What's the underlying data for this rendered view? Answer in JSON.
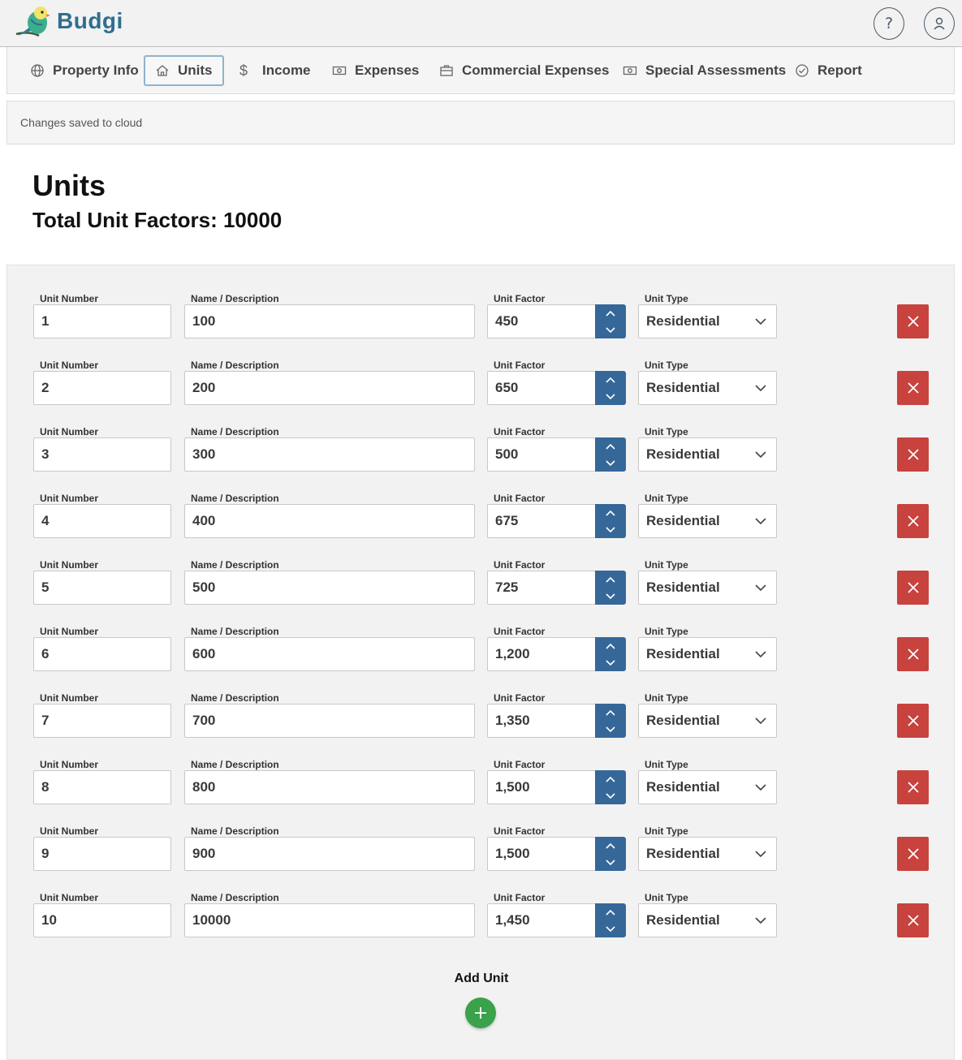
{
  "app": {
    "brand": "Budgi"
  },
  "header": {
    "help_icon": "question-icon",
    "user_icon": "user-icon"
  },
  "nav": {
    "tabs": [
      {
        "label": "Property Info",
        "icon": "globe-icon"
      },
      {
        "label": "Units",
        "icon": "home-icon",
        "active": true
      },
      {
        "label": "Income",
        "icon": "dollar-icon"
      },
      {
        "label": "Expenses",
        "icon": "cash-icon"
      },
      {
        "label": "Commercial Expenses",
        "icon": "briefcase-icon"
      },
      {
        "label": "Special Assessments",
        "icon": "cash-icon"
      },
      {
        "label": "Report",
        "icon": "check-circle-icon"
      }
    ]
  },
  "status": {
    "text": "Changes saved to cloud"
  },
  "page": {
    "title": "Units",
    "subtitle": "Total Unit Factors: 10000"
  },
  "labels": {
    "unit_number": "Unit Number",
    "name_description": "Name / Description",
    "unit_factor": "Unit Factor",
    "unit_type": "Unit Type"
  },
  "units": [
    {
      "number": "1",
      "name": "100",
      "factor": "450",
      "type": "Residential"
    },
    {
      "number": "2",
      "name": "200",
      "factor": "650",
      "type": "Residential"
    },
    {
      "number": "3",
      "name": "300",
      "factor": "500",
      "type": "Residential"
    },
    {
      "number": "4",
      "name": "400",
      "factor": "675",
      "type": "Residential"
    },
    {
      "number": "5",
      "name": "500",
      "factor": "725",
      "type": "Residential"
    },
    {
      "number": "6",
      "name": "600",
      "factor": "1,200",
      "type": "Residential"
    },
    {
      "number": "7",
      "name": "700",
      "factor": "1,350",
      "type": "Residential"
    },
    {
      "number": "8",
      "name": "800",
      "factor": "1,500",
      "type": "Residential"
    },
    {
      "number": "9",
      "name": "900",
      "factor": "1,500",
      "type": "Residential"
    },
    {
      "number": "10",
      "name": "10000",
      "factor": "1,450",
      "type": "Residential"
    }
  ],
  "add_unit": {
    "label": "Add Unit"
  },
  "colors": {
    "brand": "#2f6f8f",
    "spinner": "#356899",
    "delete": "#c8423e",
    "add": "#3aa24a",
    "active_tab_border": "#8fb3cc"
  }
}
